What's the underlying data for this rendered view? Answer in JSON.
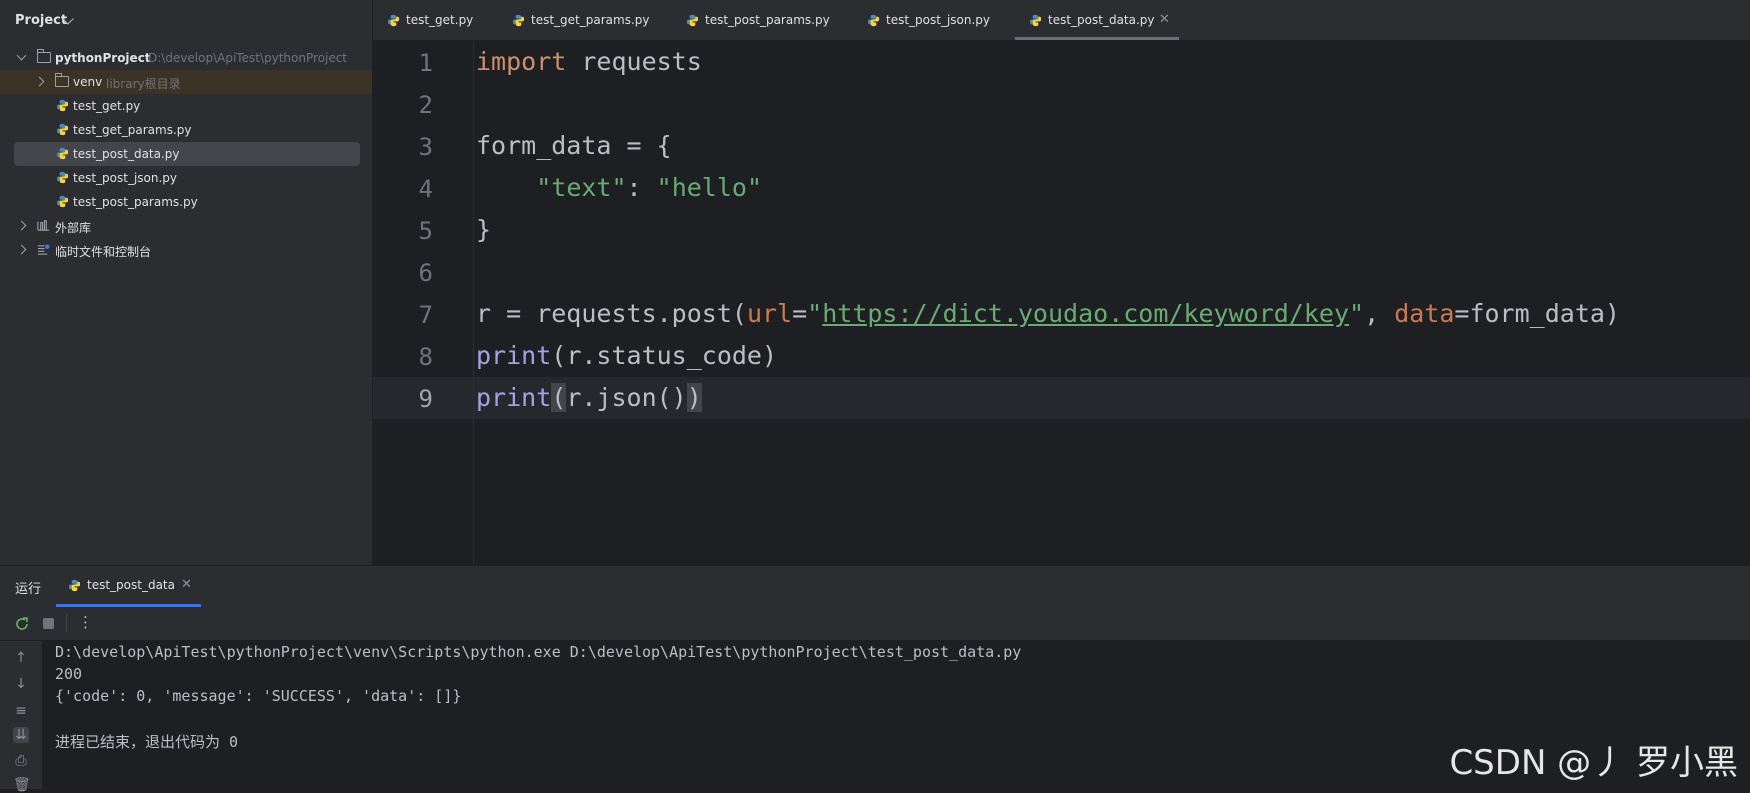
{
  "project": {
    "title": "Project",
    "tree": [
      {
        "label": "pythonProject",
        "hint": "D:\\develop\\ApiTest\\pythonProject",
        "type": "folder",
        "expanded": true
      },
      {
        "label": "venv",
        "hint": "library根目录",
        "type": "folder"
      },
      {
        "label": "test_get.py",
        "type": "py"
      },
      {
        "label": "test_get_params.py",
        "type": "py"
      },
      {
        "label": "test_post_data.py",
        "type": "py",
        "selected": true
      },
      {
        "label": "test_post_json.py",
        "type": "py"
      },
      {
        "label": "test_post_params.py",
        "type": "py"
      },
      {
        "label": "外部库",
        "type": "library"
      },
      {
        "label": "临时文件和控制台",
        "type": "scratches"
      }
    ]
  },
  "editor": {
    "tabs": [
      {
        "label": "test_get.py"
      },
      {
        "label": "test_get_params.py"
      },
      {
        "label": "test_post_params.py"
      },
      {
        "label": "test_post_json.py"
      },
      {
        "label": "test_post_data.py",
        "active": true
      }
    ],
    "line_numbers": [
      "1",
      "2",
      "3",
      "4",
      "5",
      "6",
      "7",
      "8",
      "9"
    ],
    "current_line": "9",
    "code": {
      "l1_kw": "import",
      "l1_rest": " requests",
      "l3": "form_data = {",
      "l4_key": "\"text\"",
      "l4_colon": ": ",
      "l4_val": "\"hello\"",
      "l5": "}",
      "l7_a": "r = requests.post(",
      "l7_url_param": "url",
      "l7_eq": "=",
      "l7_q1": "\"",
      "l7_url": "https://dict.youdao.com/keyword/key",
      "l7_q2": "\"",
      "l7_comma": ", ",
      "l7_data_param": "data",
      "l7_tail": "=form_data)",
      "l8_fn": "print",
      "l8_rest": "(r.status_code)",
      "l9_fn": "print",
      "l9_open": "(",
      "l9_mid": "r.json()",
      "l9_close": ")"
    }
  },
  "run": {
    "title": "运行",
    "tab_label": "test_post_data",
    "console": [
      "D:\\develop\\ApiTest\\pythonProject\\venv\\Scripts\\python.exe D:\\develop\\ApiTest\\pythonProject\\test_post_data.py",
      "200",
      "{'code': 0, 'message': 'SUCCESS', 'data': []}",
      "",
      "进程已结束，退出代码为 0"
    ]
  },
  "watermark": "CSDN @丿 罗小黑",
  "colors": {
    "keyword": "#cf8e6d",
    "string": "#6aab73",
    "function": "#a9a0e3",
    "param": "#cc7a50",
    "accent": "#3574f0"
  }
}
